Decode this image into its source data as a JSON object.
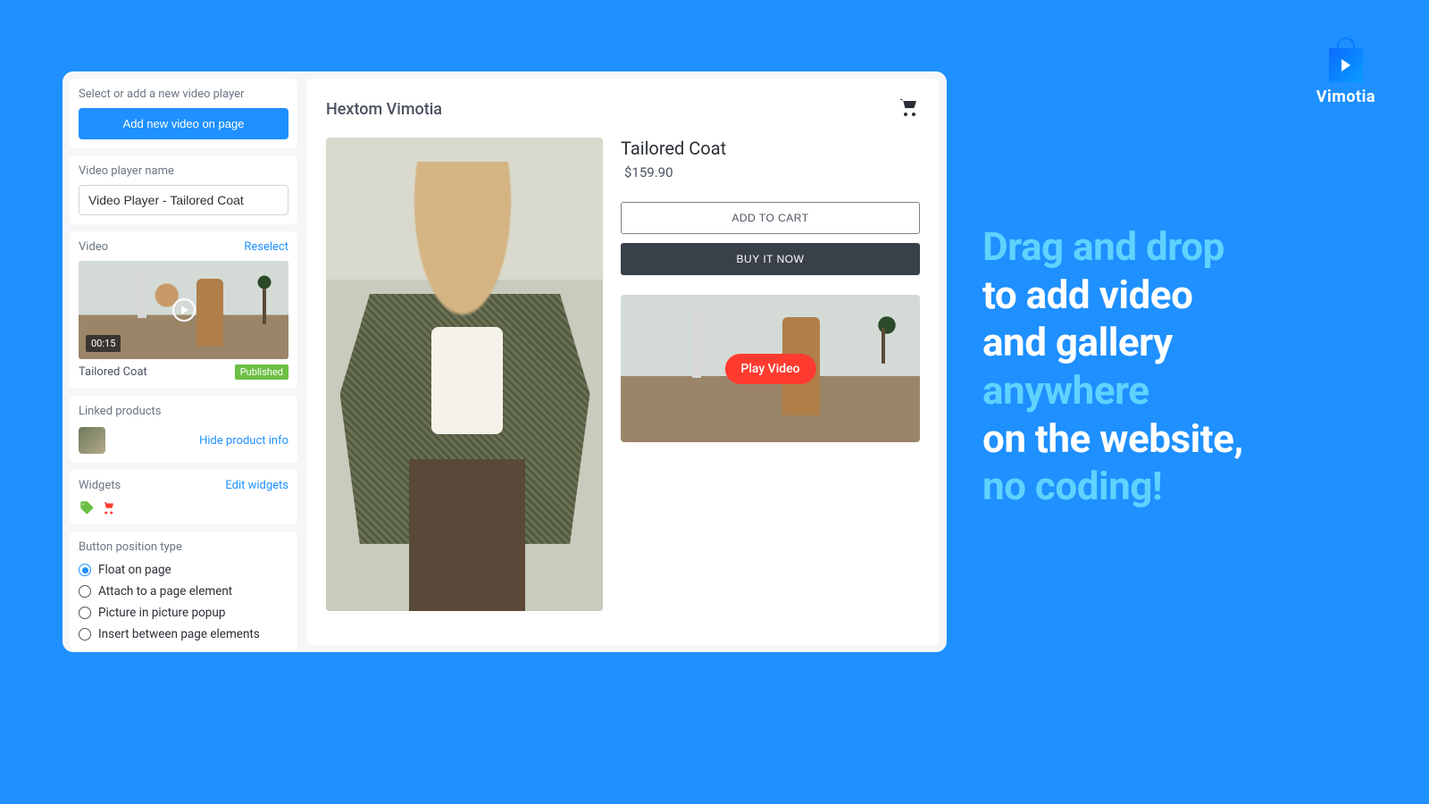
{
  "brand": {
    "name": "Vimotia"
  },
  "hero": {
    "l1": "Drag and drop",
    "l2": "to add video",
    "l3": "and gallery",
    "l4": "anywhere",
    "l5": "on the website,",
    "l6": "no coding!"
  },
  "sidebar": {
    "select_label": "Select or add a new video player",
    "add_button": "Add new video on page",
    "name_label": "Video player name",
    "name_value": "Video Player - Tailored Coat",
    "video_label": "Video",
    "reselect": "Reselect",
    "duration": "00:15",
    "video_title": "Tailored Coat",
    "status": "Published",
    "linked_label": "Linked products",
    "hide_link": "Hide product info",
    "widgets_label": "Widgets",
    "edit_widgets": "Edit widgets",
    "position_label": "Button position type",
    "positions": {
      "float": "Float on page",
      "attach": "Attach to a page element",
      "pip": "Picture in picture popup",
      "insert": "Insert between page elements"
    }
  },
  "preview": {
    "header": "Hextom Vimotia",
    "product_title": "Tailored Coat",
    "price": "$159.90",
    "add_to_cart": "ADD TO CART",
    "buy_now": "BUY IT NOW",
    "play_video": "Play Video"
  }
}
